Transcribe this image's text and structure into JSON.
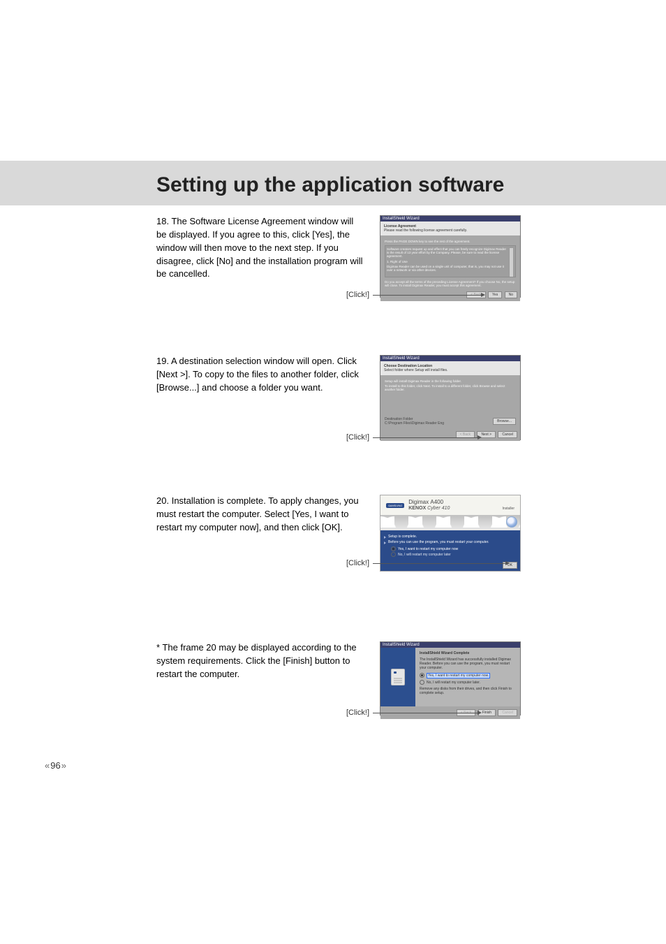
{
  "page": {
    "title": "Setting up the application software",
    "number": "96"
  },
  "click_label": "[Click!]",
  "steps": [
    {
      "num": "18.",
      "text": "The Software License Agreement window will be displayed. If you agree to this, click [Yes], the window will then move to the next step. If you disagree, click [No] and the installation program will be cancelled."
    },
    {
      "num": "19.",
      "text": "A destination selection window will open. Click [Next >]. To copy to the files to another folder, click [Browse...] and choose a folder you want."
    },
    {
      "num": "20.",
      "text": "Installation is complete. To apply changes, you must restart the computer. Select [Yes, I want to restart my computer now], and then click [OK]."
    },
    {
      "num": "*",
      "text": "The frame 20 may be displayed according to the system requirements. Click the [Finish] button to restart the computer."
    }
  ],
  "dlg1": {
    "titlebar": "InstallShield Wizard",
    "head_title": "License Agreement",
    "head_sub": "Please read the following license agreement carefully.",
    "pagedown": "Press the PAGE DOWN key to see the rest of the agreement.",
    "body1": "Software creators request up and effect that you can freely recognize Digimax Reader is the result of 13 year effort by the Company. Please, be sure to read the license agreement.",
    "body2": "1. Right of Use",
    "body3": "Digimax Reader can be used on a single unit of computer, that is, you may not use it over a network or via other devices.",
    "confirm": "Do you accept all the terms of the preceding License Agreement? If you choose No, the setup will close. To install Digimax Reader, you must accept this agreement.",
    "btn_back": "< Back",
    "btn_yes": "Yes",
    "btn_no": "No"
  },
  "dlg2": {
    "titlebar": "InstallShield Wizard",
    "head_title": "Choose Destination Location",
    "head_sub": "Select folder where Setup will install files.",
    "body1": "Setup will install Digimax Reader in the following folder.",
    "body2": "To install to this folder, click Next. To install to a different folder, click Browse and select another folder.",
    "dest_label": "Destination Folder",
    "dest_path": "C:\\Program Files\\Digimax Reader Eng",
    "btn_browse": "Browse...",
    "btn_back": "< Back",
    "btn_next": "Next >",
    "btn_cancel": "Cancel"
  },
  "dlg3": {
    "brand_logo": "SAMSUNG",
    "brand_l1a": "Digimax",
    "brand_l1b": "A400",
    "brand_l2a": "KENOX",
    "brand_l2b": "Cyber 410",
    "installer": "Installer",
    "line1": "Setup is complete.",
    "line2": "Before you can use the program, you must restart your computer.",
    "opt_yes": "Yes, I want to restart my computer now",
    "opt_no": "No, I will restart my computer later",
    "btn_ok": "OK"
  },
  "dlg4": {
    "titlebar": "InstallShield Wizard",
    "head": "InstallShield Wizard Complete",
    "body1": "The InstallShield Wizard has successfully installed Digimax Reader. Before you can use the program, you must restart your computer.",
    "opt_yes": "Yes, I want to restart my computer now.",
    "opt_no": "No, I will restart my computer later.",
    "body2": "Remove any disks from their drives, and then click Finish to complete setup.",
    "btn_back": "< Back",
    "btn_finish": "Finish",
    "btn_cancel": "Cancel"
  }
}
